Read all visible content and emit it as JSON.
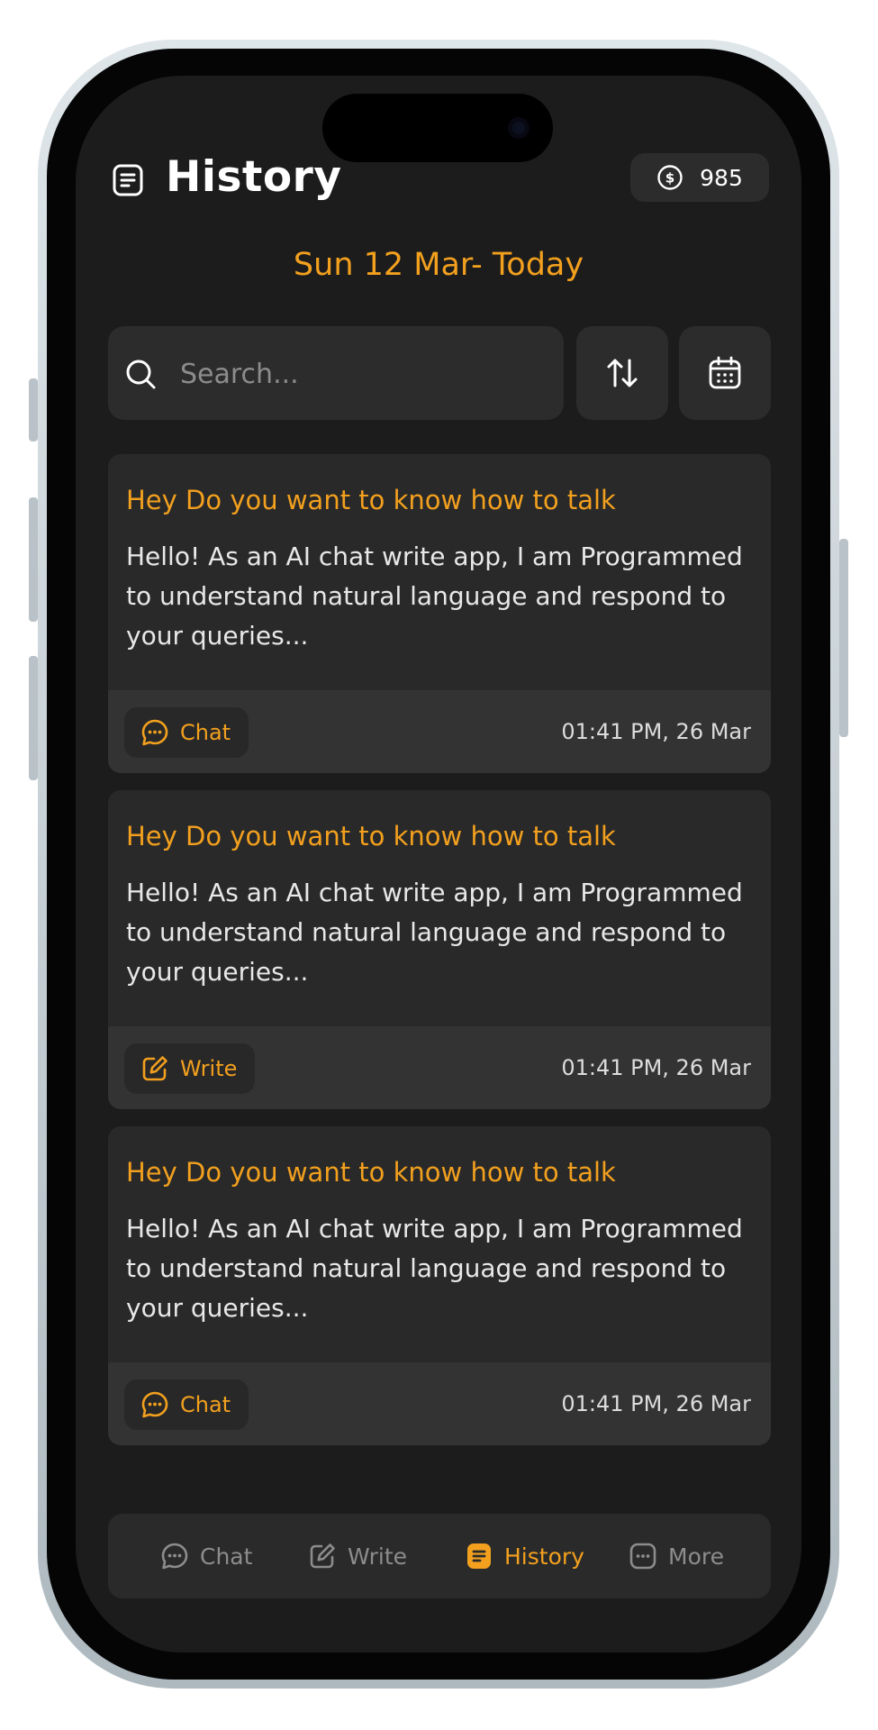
{
  "header": {
    "title": "History",
    "coins": "985"
  },
  "date_range": "Sun 12 Mar- Today",
  "search": {
    "placeholder": "Search...",
    "value": ""
  },
  "cards": [
    {
      "title": "Hey Do you want to know how to talk",
      "body": "Hello! As an AI chat write app, I am Programmed to understand natural language and respond to your queries...",
      "tag": "Chat",
      "tag_icon": "chat-bubble-icon",
      "timestamp": "01:41 PM, 26 Mar"
    },
    {
      "title": "Hey Do you want to know how to talk",
      "body": "Hello! As an AI chat write app, I am Programmed to understand natural language and respond to your queries...",
      "tag": "Write",
      "tag_icon": "edit-icon",
      "timestamp": "01:41 PM, 26 Mar"
    },
    {
      "title": "Hey Do you want to know how to talk",
      "body": "Hello! As an AI chat write app, I am Programmed to understand natural language and respond to your queries...",
      "tag": "Chat",
      "tag_icon": "chat-bubble-icon",
      "timestamp": "01:41 PM, 26 Mar"
    }
  ],
  "nav": {
    "items": [
      {
        "label": "Chat",
        "icon": "chat-bubble-icon",
        "active": false
      },
      {
        "label": "Write",
        "icon": "edit-icon",
        "active": false
      },
      {
        "label": "History",
        "icon": "history-doc-icon",
        "active": true
      },
      {
        "label": "More",
        "icon": "more-dots-icon",
        "active": false
      }
    ]
  },
  "colors": {
    "accent": "#f2a01e",
    "background": "#1c1c1c",
    "surface": "#292929",
    "inactive": "#8c8c8c"
  }
}
